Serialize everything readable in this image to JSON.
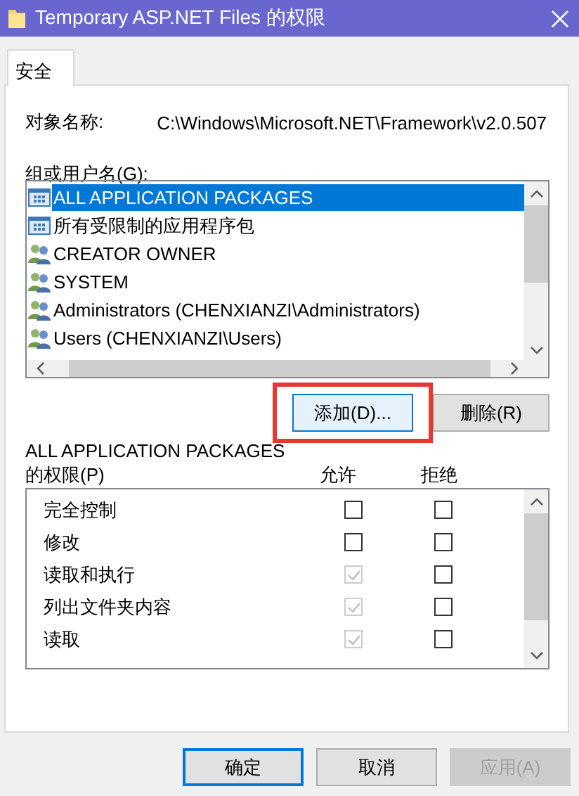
{
  "window": {
    "title": "Temporary ASP.NET Files 的权限"
  },
  "tabs": [
    {
      "label": "安全",
      "selected": true
    }
  ],
  "object_name": {
    "label": "对象名称:",
    "value": "C:\\Windows\\Microsoft.NET\\Framework\\v2.0.507"
  },
  "principals": {
    "label": "组或用户名(G):",
    "items": [
      {
        "name": "ALL APPLICATION PACKAGES",
        "kind": "package",
        "selected": true
      },
      {
        "name": "所有受限制的应用程序包",
        "kind": "package",
        "selected": false
      },
      {
        "name": "CREATOR OWNER",
        "kind": "group",
        "selected": false
      },
      {
        "name": "SYSTEM",
        "kind": "group",
        "selected": false
      },
      {
        "name": "Administrators (CHENXIANZI\\Administrators)",
        "kind": "group",
        "selected": false
      },
      {
        "name": "Users (CHENXIANZI\\Users)",
        "kind": "group",
        "selected": false
      }
    ]
  },
  "principal_buttons": [
    {
      "label": "添加(D)...",
      "focused": true,
      "highlighted": true
    },
    {
      "label": "删除(R)",
      "focused": false,
      "highlighted": false
    }
  ],
  "permissions": {
    "title": "ALL APPLICATION PACKAGES",
    "label": "的权限(P)",
    "allow_header": "允许",
    "deny_header": "拒绝",
    "rows": [
      {
        "name": "完全控制",
        "allow": {
          "checked": false,
          "disabled": false
        },
        "deny": {
          "checked": false,
          "disabled": false
        }
      },
      {
        "name": "修改",
        "allow": {
          "checked": false,
          "disabled": false
        },
        "deny": {
          "checked": false,
          "disabled": false
        }
      },
      {
        "name": "读取和执行",
        "allow": {
          "checked": true,
          "disabled": true
        },
        "deny": {
          "checked": false,
          "disabled": false
        }
      },
      {
        "name": "列出文件夹内容",
        "allow": {
          "checked": true,
          "disabled": true
        },
        "deny": {
          "checked": false,
          "disabled": false
        }
      },
      {
        "name": "读取",
        "allow": {
          "checked": true,
          "disabled": true
        },
        "deny": {
          "checked": false,
          "disabled": false
        }
      }
    ]
  },
  "buttons": [
    {
      "label": "确定",
      "default": true,
      "disabled": false
    },
    {
      "label": "取消",
      "default": false,
      "disabled": false
    },
    {
      "label": "应用(A)",
      "default": false,
      "disabled": true
    }
  ]
}
